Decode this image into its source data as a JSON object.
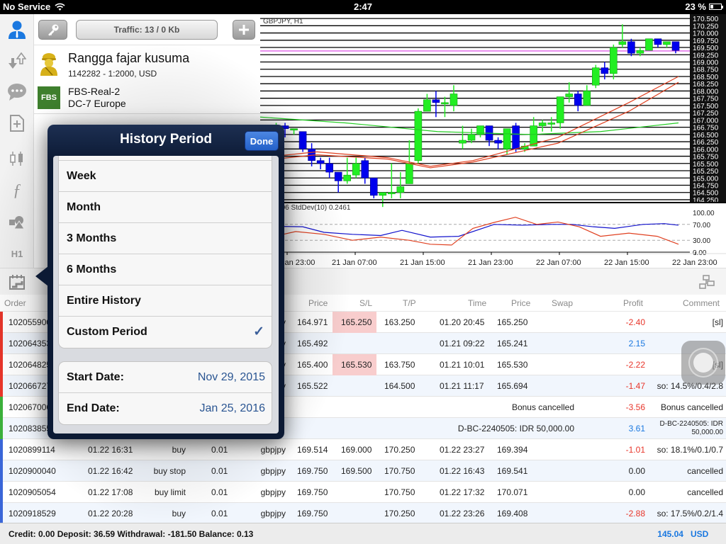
{
  "status_bar": {
    "carrier": "No Service",
    "time": "2:47",
    "battery": "23 %",
    "battery_level": 0.23
  },
  "sidebar": {
    "items": [
      {
        "name": "account-icon",
        "active": true
      },
      {
        "name": "trade-icon"
      },
      {
        "name": "chat-icon"
      },
      {
        "name": "new-document-icon"
      },
      {
        "name": "candlestick-icon"
      },
      {
        "name": "function-icon"
      },
      {
        "name": "objects-icon"
      },
      {
        "name": "timeframe",
        "label": "H1"
      }
    ]
  },
  "account_panel": {
    "traffic": "Traffic: 13 / 0 Kb",
    "name": "Rangga fajar kusuma",
    "details": "1142282 - 1:2000, USD",
    "broker_logo": "FBS",
    "server": "FBS-Real-2",
    "datacenter": "DC-7 Europe"
  },
  "chart": {
    "symbol": "GBPJPY, H1",
    "indicator_label": "0) 60.06 StdDev(10) 0.2461",
    "price_axis": [
      "170.500",
      "170.250",
      "170.000",
      "169.750",
      "169.500",
      "169.250",
      "169.000",
      "168.750",
      "168.500",
      "168.250",
      "168.000",
      "167.750",
      "167.500",
      "167.250",
      "167.000",
      "166.750",
      "166.500",
      "166.250",
      "166.000",
      "165.750",
      "165.500",
      "165.250",
      "165.000",
      "164.750",
      "164.500",
      "164.250"
    ],
    "indicator_axis": [
      "100.00",
      "70.00",
      "30.00",
      "0.00"
    ],
    "time_axis": [
      "Jan 23:00",
      "21 Jan 07:00",
      "21 Jan 15:00",
      "21 Jan 23:00",
      "22 Jan 07:00",
      "22 Jan 15:00",
      "22 Jan 23:00"
    ],
    "current_price": 169.38,
    "candles": [
      [
        166.2,
        166.6,
        165.9,
        166.7
      ],
      [
        166.6,
        166.8,
        166.4,
        166.9
      ],
      [
        166.8,
        166.7,
        166.4,
        166.9
      ],
      [
        166.7,
        166.7,
        166.5,
        166.7
      ],
      [
        166.6,
        166.0,
        165.9,
        166.6
      ],
      [
        166.0,
        165.6,
        165.4,
        166.2
      ],
      [
        165.6,
        165.5,
        165.3,
        165.7
      ],
      [
        165.5,
        165.2,
        165.0,
        165.7
      ],
      [
        165.2,
        164.9,
        164.5,
        165.2
      ],
      [
        164.9,
        165.1,
        164.8,
        165.7
      ],
      [
        165.1,
        165.5,
        165.0,
        165.7
      ],
      [
        165.6,
        165.0,
        164.8,
        165.7
      ],
      [
        165.0,
        164.4,
        164.3,
        165.0
      ],
      [
        164.4,
        164.5,
        164.0,
        164.5
      ],
      [
        164.5,
        164.5,
        164.3,
        165.5
      ],
      [
        164.5,
        164.7,
        164.3,
        165.2
      ],
      [
        164.8,
        165.5,
        164.8,
        166.3
      ],
      [
        165.6,
        167.3,
        165.5,
        167.4
      ],
      [
        167.3,
        167.7,
        167.3,
        167.9
      ],
      [
        167.7,
        167.6,
        167.1,
        168.0
      ],
      [
        167.6,
        167.6,
        167.1,
        167.8
      ],
      [
        167.5,
        167.9,
        167.3,
        168.2
      ],
      [
        166.2,
        166.3,
        166.0,
        166.8
      ],
      [
        166.3,
        166.5,
        166.2,
        166.7
      ],
      [
        166.5,
        166.8,
        166.4,
        166.8
      ],
      [
        166.8,
        166.3,
        166.1,
        166.8
      ],
      [
        166.3,
        166.2,
        166.0,
        166.4
      ],
      [
        166.0,
        166.7,
        165.8,
        166.7
      ],
      [
        166.8,
        166.0,
        165.9,
        166.9
      ],
      [
        166.0,
        166.1,
        165.9,
        166.2
      ],
      [
        166.1,
        166.8,
        166.1,
        167.1
      ],
      [
        166.8,
        166.9,
        166.6,
        167.0
      ],
      [
        166.9,
        166.9,
        166.6,
        167.1
      ],
      [
        166.9,
        167.8,
        166.7,
        167.8
      ],
      [
        167.8,
        167.9,
        167.6,
        168.3
      ],
      [
        167.9,
        167.5,
        167.3,
        168.0
      ],
      [
        167.5,
        168.0,
        167.5,
        168.2
      ],
      [
        168.2,
        168.8,
        168.1,
        168.9
      ],
      [
        168.8,
        168.6,
        168.4,
        169.0
      ],
      [
        168.6,
        169.5,
        168.4,
        169.6
      ],
      [
        169.6,
        169.7,
        169.5,
        170.3
      ],
      [
        169.7,
        169.3,
        169.2,
        169.8
      ],
      [
        169.3,
        169.4,
        169.2,
        169.5
      ],
      [
        169.4,
        169.8,
        169.4,
        169.8
      ],
      [
        169.8,
        169.6,
        169.5,
        169.8
      ],
      [
        169.6,
        169.7,
        169.5,
        169.7
      ],
      [
        169.7,
        169.4,
        169.3,
        169.7
      ]
    ]
  },
  "history_period": {
    "title": "History Period",
    "done_label": "Done",
    "options": [
      {
        "label": "Week"
      },
      {
        "label": "Month"
      },
      {
        "label": "3 Months"
      },
      {
        "label": "6 Months"
      },
      {
        "label": "Entire History"
      },
      {
        "label": "Custom Period",
        "selected": true
      }
    ],
    "start_date_label": "Start Date:",
    "start_date": "Nov 29, 2015",
    "end_date_label": "End Date:",
    "end_date": "Jan 25, 2016"
  },
  "table": {
    "headers": {
      "order": "Order",
      "price": "Price",
      "sl": "S/L",
      "tp": "T/P",
      "time": "Time",
      "close_price": "Price",
      "swap": "Swap",
      "profit": "Profit",
      "comment": "Comment"
    },
    "rows": [
      {
        "marker": "#e8352a",
        "order": "1020559001",
        "open_time": "",
        "type": "",
        "volume": "",
        "symbol": "y",
        "price": "164.971",
        "sl": "165.250",
        "sl_hl": true,
        "tp": "163.250",
        "time": "01.20 20:45",
        "close_price": "165.250",
        "swap": "",
        "profit": "-2.40",
        "profit_class": "neg",
        "comment": "[sl]"
      },
      {
        "marker": "#e8352a",
        "order": "1020643533",
        "open_time": "",
        "type": "",
        "volume": "",
        "symbol": "y",
        "price": "165.492",
        "sl": "",
        "tp": "",
        "time": "01.21 09:22",
        "close_price": "165.241",
        "swap": "",
        "profit": "2.15",
        "profit_class": "pos",
        "comment": ""
      },
      {
        "marker": "#e8352a",
        "order": "1020648255",
        "open_time": "",
        "type": "",
        "volume": "",
        "symbol": "y",
        "price": "165.400",
        "sl": "165.530",
        "sl_hl": true,
        "tp": "163.750",
        "time": "01.21 10:01",
        "close_price": "165.530",
        "swap": "",
        "profit": "-2.22",
        "profit_class": "neg",
        "comment": "[sl]"
      },
      {
        "marker": "#e8352a",
        "order": "1020667271",
        "open_time": "",
        "type": "",
        "volume": "",
        "symbol": "y",
        "price": "165.522",
        "sl": "",
        "tp": "164.500",
        "time": "01.21 11:17",
        "close_price": "165.694",
        "swap": "",
        "profit": "-1.47",
        "profit_class": "neg",
        "comment": "so: 14.5%/0.4/2.8"
      },
      {
        "marker": "#3bb03b",
        "order": "1020670061",
        "wide": "Bonus cancelled",
        "profit": "-3.56",
        "profit_class": "neg",
        "comment": "Bonus cancelled"
      },
      {
        "marker": "#3bb03b",
        "order": "1020838551",
        "wide": "D-BC-2240505: IDR 50,000.00",
        "profit": "3.61",
        "profit_class": "pos",
        "comment": "D-BC-2240505: IDR 50,000.00",
        "comment_small": true
      },
      {
        "marker": "#3a66d8",
        "order": "1020899114",
        "open_time": "01.22 16:31",
        "type": "buy",
        "volume": "0.01",
        "symbol": "gbpjpy",
        "price": "169.514",
        "sl": "169.000",
        "tp": "170.250",
        "time": "01.22 23:27",
        "close_price": "169.394",
        "swap": "",
        "profit": "-1.01",
        "profit_class": "neg",
        "comment": "so: 18.1%/0.1/0.7"
      },
      {
        "marker": "#3a66d8",
        "order": "1020900040",
        "open_time": "01.22 16:42",
        "type": "buy stop",
        "volume": "0.01",
        "symbol": "gbpjpy",
        "price": "169.750",
        "sl": "169.500",
        "tp": "170.750",
        "time": "01.22 16:43",
        "close_price": "169.541",
        "swap": "",
        "profit": "0.00",
        "profit_class": "",
        "comment": "cancelled"
      },
      {
        "marker": "#3a66d8",
        "order": "1020905054",
        "open_time": "01.22 17:08",
        "type": "buy limit",
        "volume": "0.01",
        "symbol": "gbpjpy",
        "price": "169.750",
        "sl": "",
        "tp": "170.750",
        "time": "01.22 17:32",
        "close_price": "170.071",
        "swap": "",
        "profit": "0.00",
        "profit_class": "",
        "comment": "cancelled"
      },
      {
        "marker": "#3a66d8",
        "order": "1020918529",
        "open_time": "01.22 20:28",
        "type": "buy",
        "volume": "0.01",
        "symbol": "gbpjpy",
        "price": "169.750",
        "sl": "",
        "tp": "170.250",
        "time": "01.22 23:26",
        "close_price": "169.408",
        "swap": "",
        "profit": "-2.88",
        "profit_class": "neg",
        "comment": "so: 17.5%/0.2/1.4"
      }
    ]
  },
  "footer": {
    "summary": "Credit: 0.00 Deposit: 36.59 Withdrawal: -181.50 Balance: 0.13",
    "total": "145.04",
    "currency": "USD"
  }
}
